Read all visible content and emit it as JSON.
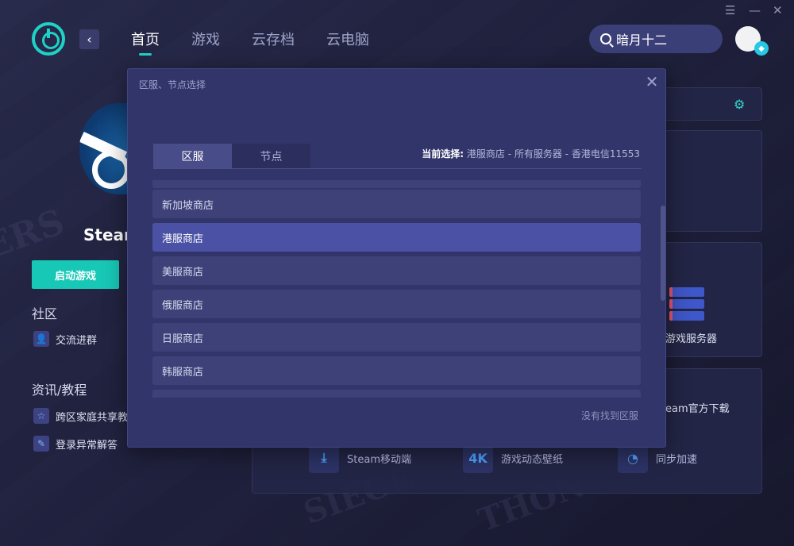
{
  "app": {
    "nav": [
      "首页",
      "游戏",
      "云存档",
      "云电脑"
    ],
    "active_nav_index": 0,
    "search_value": "暗月十二",
    "window_controls": [
      "menu-icon",
      "minimize-icon",
      "close-icon"
    ]
  },
  "left_panel": {
    "game_title": "Steam",
    "launch_button": "启动游戏",
    "community_title": "社区",
    "community_link": "交流进群",
    "info_title": "资讯/教程",
    "info_links": [
      "跨区家庭共享教",
      "登录异常解答"
    ]
  },
  "right_panel": {
    "server_label": "游戏服务器",
    "download_label": "eam官方下载",
    "tools": [
      {
        "label": "Steam移动端",
        "icon": "download-icon"
      },
      {
        "label": "游戏动态壁纸",
        "icon": "4k-icon"
      },
      {
        "label": "同步加速",
        "icon": "speed-icon"
      }
    ]
  },
  "modal": {
    "title": "区服、节点选择",
    "tabs": [
      "区服",
      "节点"
    ],
    "active_tab_index": 0,
    "current_selection_label": "当前选择:",
    "current_selection_value": "港服商店 - 所有服务器 - 香港电信11553",
    "regions": [
      "新加坡商店",
      "港服商店",
      "美服商店",
      "俄服商店",
      "日服商店",
      "韩服商店"
    ],
    "selected_region": "港服商店",
    "not_found_link": "没有找到区服"
  },
  "colors": {
    "accent": "#1ed3c6",
    "selected_item": "#4b52a5",
    "modal_bg": "#32356a"
  }
}
